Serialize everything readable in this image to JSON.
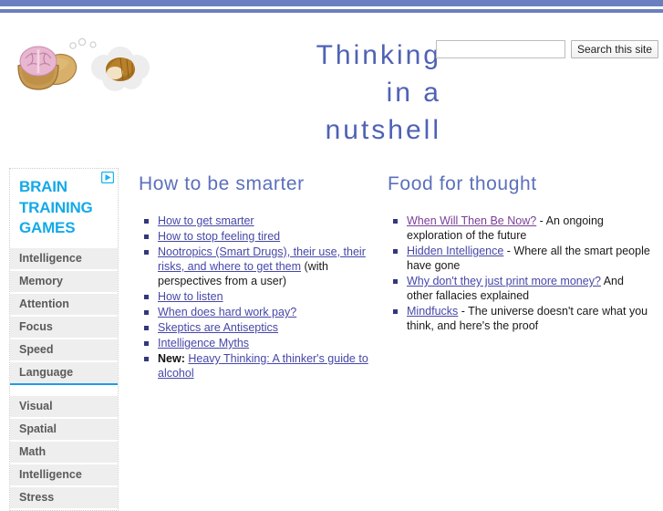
{
  "site": {
    "title_lines": [
      "Thinking",
      "in a",
      "nutshell"
    ],
    "title_color": "#4f62b5",
    "stripe_color": "#6a7fc0"
  },
  "logo": {
    "name": "walnut-brain-logo",
    "alt": "Walnut shell containing a brain next to a thought bubble with a nut"
  },
  "search": {
    "value": "",
    "placeholder": "",
    "button_label": "Search this site"
  },
  "ad": {
    "headline": "BRAIN TRAINING GAMES",
    "headline_color": "#14a9e8",
    "adchoices_icon": "adchoices-triangle-icon",
    "group_1": [
      "Intelligence",
      "Memory",
      "Attention",
      "Focus",
      "Speed",
      "Language"
    ],
    "group_2": [
      "Visual",
      "Spatial",
      "Math",
      "Intelligence",
      "Stress"
    ]
  },
  "columns": [
    {
      "heading": "How to be smarter",
      "items": [
        {
          "link": "How to get smarter",
          "rest": "",
          "visited": false,
          "new": false
        },
        {
          "link": "How to stop feeling tired",
          "rest": "",
          "visited": false,
          "new": false
        },
        {
          "link": "Nootropics (Smart Drugs), their use, their risks, and where to get them",
          "rest": " (with perspectives from a user)",
          "visited": false,
          "new": false
        },
        {
          "link": "How to listen",
          "rest": "",
          "visited": false,
          "new": false
        },
        {
          "link": "When does hard work pay?",
          "rest": "",
          "visited": false,
          "new": false
        },
        {
          "link": "Skeptics are Antiseptics",
          "rest": "",
          "visited": false,
          "new": false
        },
        {
          "link": "Intelligence Myths",
          "rest": "",
          "visited": false,
          "new": false
        },
        {
          "link": "Heavy Thinking: A thinker's guide to alcohol",
          "rest": "",
          "visited": false,
          "new": true,
          "new_label": "New:"
        }
      ]
    },
    {
      "heading": "Food for thought",
      "items": [
        {
          "link": "When Will Then Be Now?",
          "rest": " - An ongoing exploration of the future",
          "visited": true,
          "new": false
        },
        {
          "link": "Hidden Intelligence",
          "rest": " - Where all the smart people have gone",
          "visited": false,
          "new": false
        },
        {
          "link": "Why don't they just print more money?",
          "rest": " And other fallacies explained",
          "visited": false,
          "new": false
        },
        {
          "link": "Mindfucks",
          "rest": " - The universe doesn't care what you think, and here's the proof",
          "visited": false,
          "new": false
        }
      ]
    }
  ]
}
